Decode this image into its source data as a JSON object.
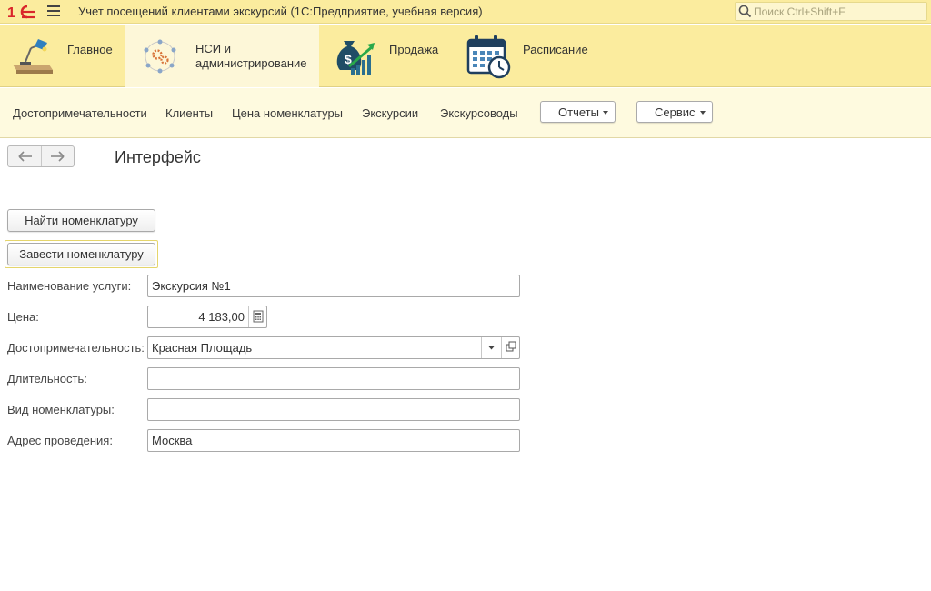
{
  "titlebar": {
    "app_title": "Учет посещений клиентами экскурсий  (1С:Предприятие, учебная версия)",
    "search_placeholder": "Поиск Ctrl+Shift+F"
  },
  "sections": [
    {
      "label": "Главное",
      "icon": "desk-lamp-icon",
      "active": false
    },
    {
      "label_line1": "НСИ и",
      "label_line2": "администрирование",
      "icon": "gears-network-icon",
      "active": true
    },
    {
      "label": "Продажа",
      "icon": "money-bag-growth-icon",
      "active": false
    },
    {
      "label": "Расписание",
      "icon": "calendar-clock-icon",
      "active": false
    }
  ],
  "funcbar": {
    "links": [
      "Достопримечательности",
      "Клиенты",
      "Цена номенклатуры",
      "Экскурсии",
      "Экскурсоводы"
    ],
    "reports_label": "Отчеты",
    "service_label": "Сервис"
  },
  "form": {
    "title": "Интерфейс",
    "find_button": "Найти номенклатуру",
    "create_button": "Завести номенклатуру",
    "fields": {
      "service_name": {
        "label": "Наименование услуги:",
        "value": "Экскурсия №1"
      },
      "price": {
        "label": "Цена:",
        "value": "4 183,00"
      },
      "attraction": {
        "label": "Достопримечательность:",
        "value": "Красная Площадь"
      },
      "duration": {
        "label": "Длительность:",
        "value": ""
      },
      "nomenclature_kind": {
        "label": "Вид номенклатуры:",
        "value": ""
      },
      "address": {
        "label": "Адрес проведения:",
        "value": "Москва"
      }
    }
  },
  "colors": {
    "titlebar_bg": "#fbec9e",
    "section_active_bg": "#fdf7d8",
    "funcbar_bg": "#fefadf",
    "logo_red": "#d9262b"
  }
}
